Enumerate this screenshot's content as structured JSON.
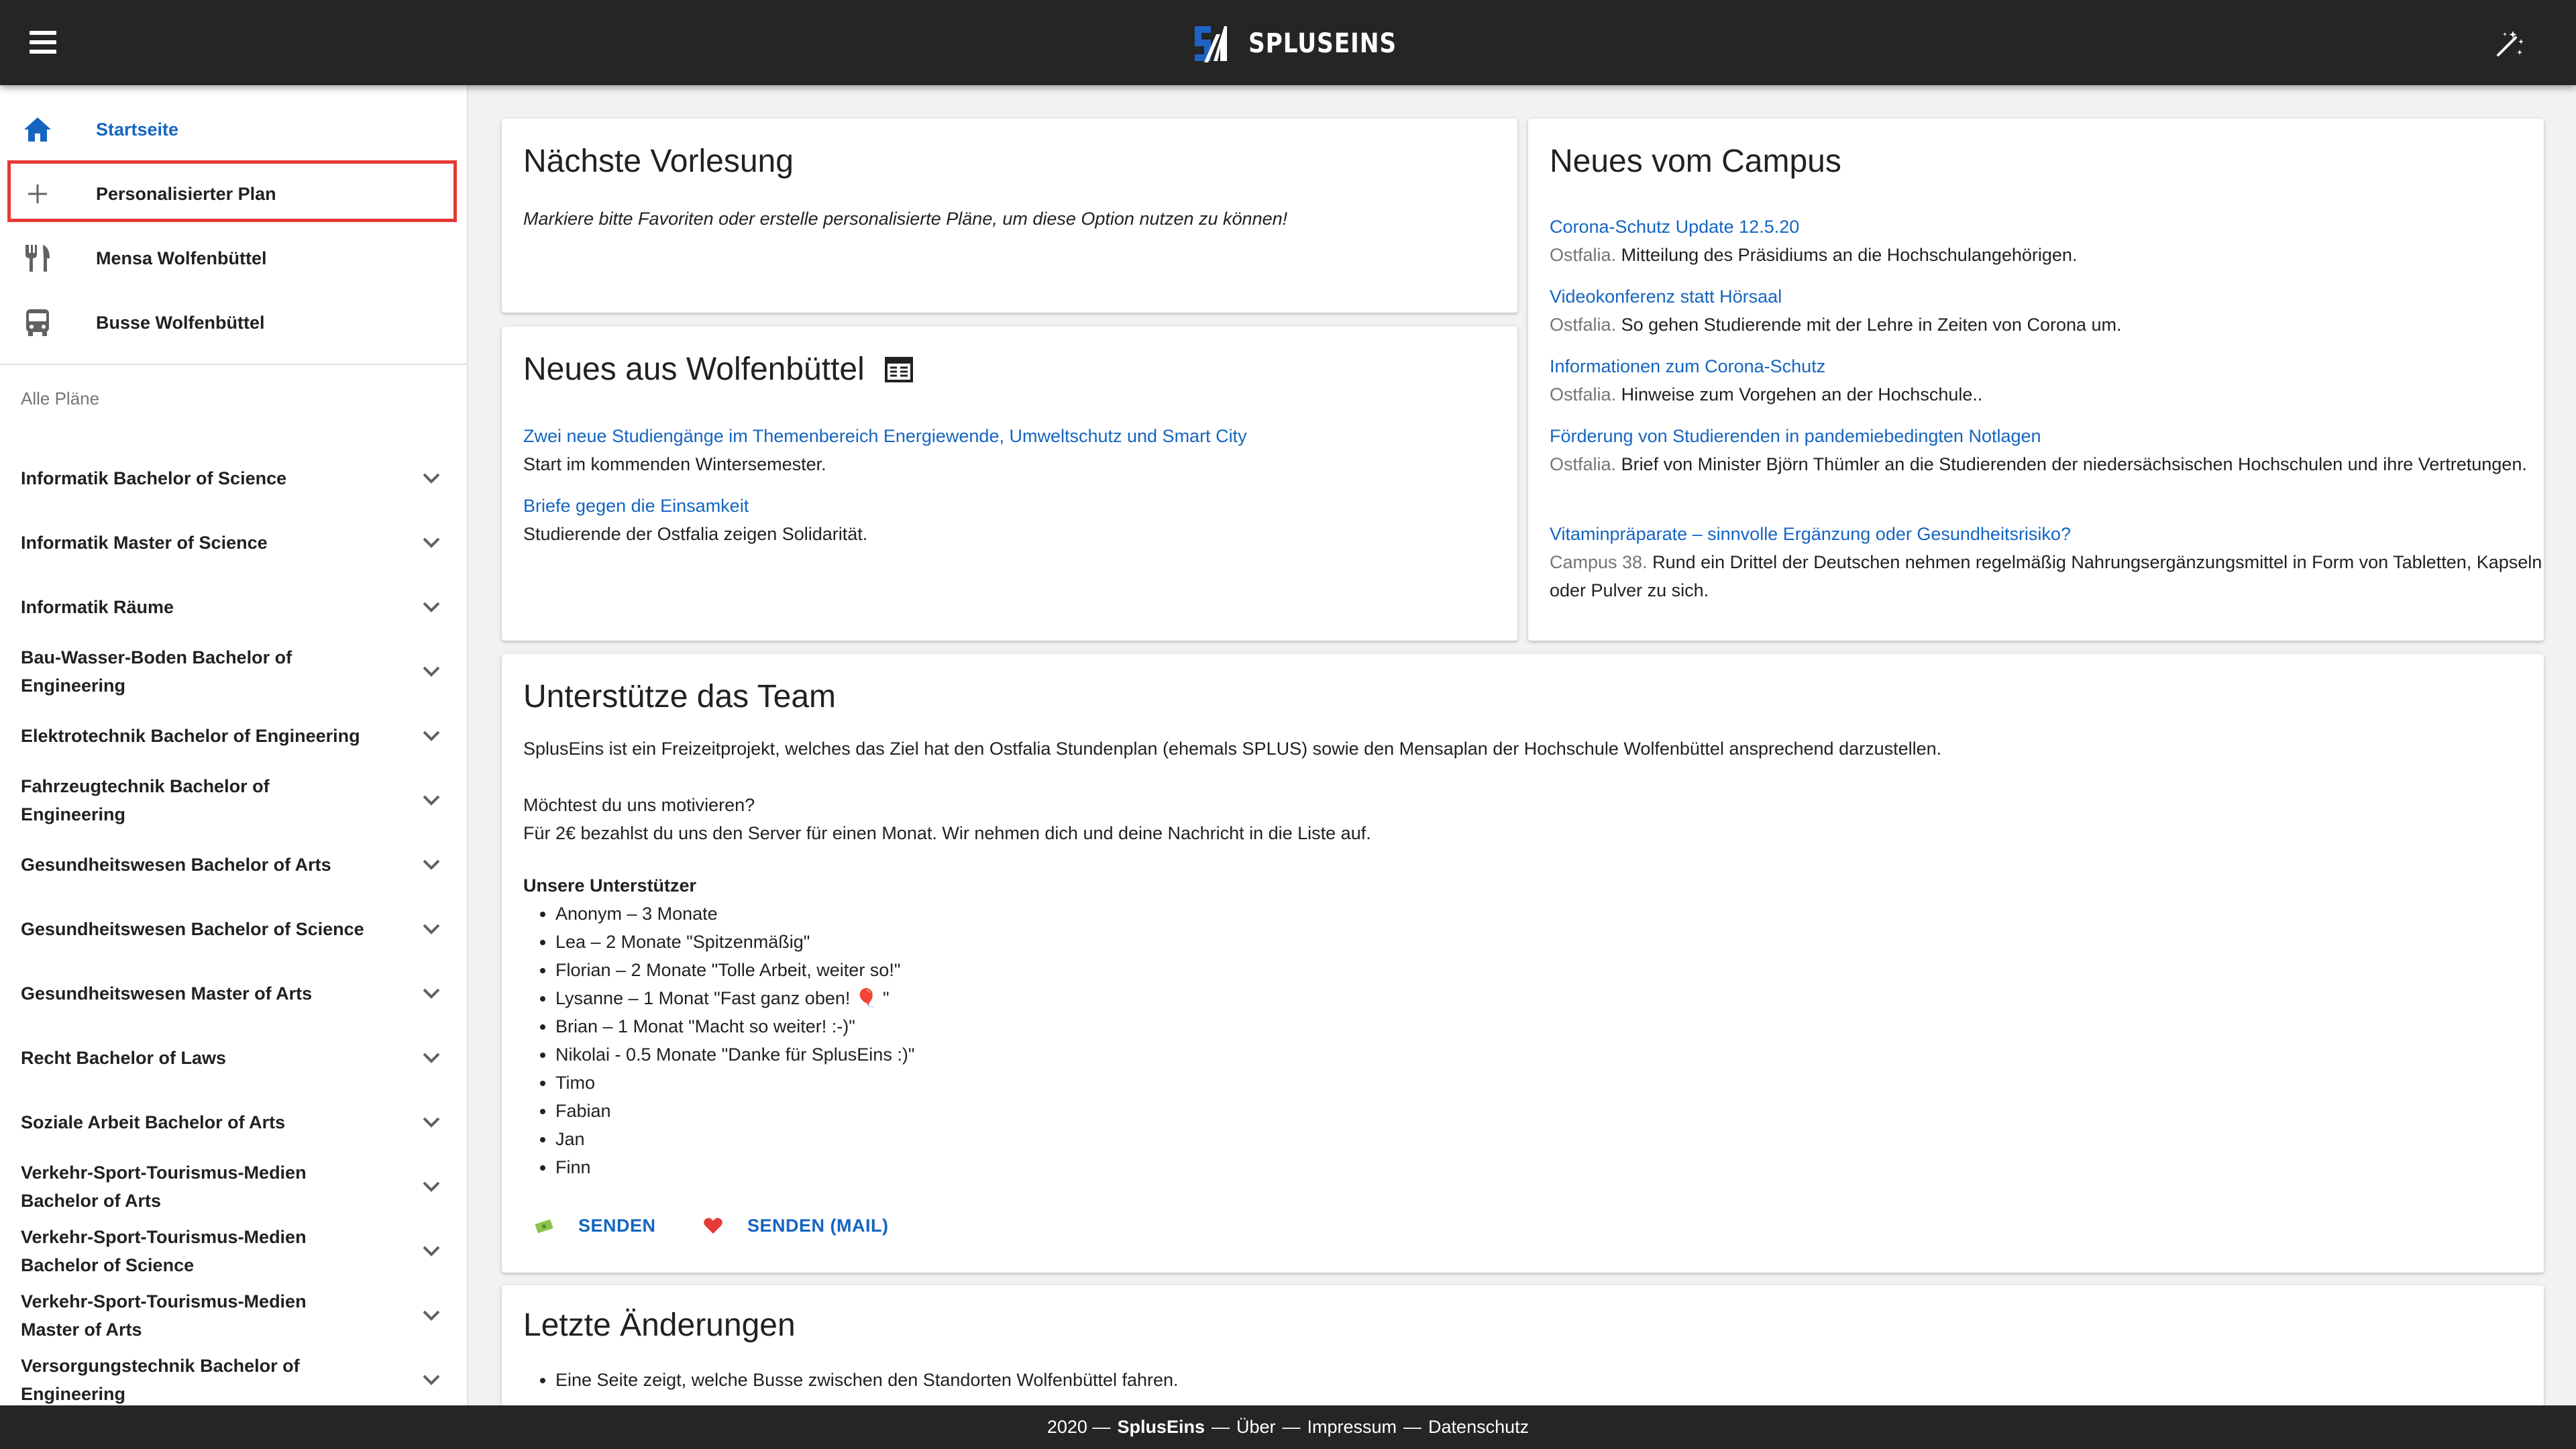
{
  "app": {
    "name": "SPLUSEINS"
  },
  "sidebar": {
    "nav": [
      {
        "label": "Startseite",
        "icon": "home-icon"
      },
      {
        "label": "Personalisierter Plan",
        "icon": "plus-icon"
      },
      {
        "label": "Mensa Wolfenbüttel",
        "icon": "restaurant-icon"
      },
      {
        "label": "Busse Wolfenbüttel",
        "icon": "bus-icon"
      }
    ],
    "subheader": "Alle Pläne",
    "plans": [
      "Informatik Bachelor of Science",
      "Informatik Master of Science",
      "Informatik Räume",
      "Bau-Wasser-Boden Bachelor of Engineering",
      "Elektrotechnik Bachelor of Engineering",
      "Fahrzeugtechnik Bachelor of Engineering",
      "Gesundheitswesen Bachelor of Arts",
      "Gesundheitswesen Bachelor of Science",
      "Gesundheitswesen Master of Arts",
      "Recht Bachelor of Laws",
      "Soziale Arbeit Bachelor of Arts",
      "Verkehr-Sport-Tourismus-Medien Bachelor of Arts",
      "Verkehr-Sport-Tourismus-Medien Bachelor of Science",
      "Verkehr-Sport-Tourismus-Medien Master of Arts",
      "Versorgungstechnik Bachelor of Engineering"
    ]
  },
  "next_lecture": {
    "title": "Nächste Vorlesung",
    "message": "Markiere bitte Favoriten oder erstelle personalisierte Pläne, um diese Option nutzen zu können!"
  },
  "wolfenbuettel_news": {
    "title": "Neues aus Wolfenbüttel",
    "items": [
      {
        "link": "Zwei neue Studiengänge im Themenbereich Energiewende, Umweltschutz und Smart City",
        "text": "Start im kommenden Wintersemester."
      },
      {
        "link": "Briefe gegen die Einsamkeit",
        "text": "Studierende der Ostfalia zeigen Solidarität."
      }
    ]
  },
  "campus_news": {
    "title": "Neues vom Campus",
    "items": [
      {
        "link": "Corona-Schutz Update 12.5.20",
        "source": "Ostfalia.",
        "text": "Mitteilung des Präsidiums an die Hochschulangehörigen."
      },
      {
        "link": "Videokonferenz statt Hörsaal",
        "source": "Ostfalia.",
        "text": "So gehen Studierende mit der Lehre in Zeiten von Corona um."
      },
      {
        "link": "Informationen zum Corona-Schutz",
        "source": "Ostfalia.",
        "text": "Hinweise zum Vorgehen an der Hochschule.."
      },
      {
        "link": "Förderung von Studierenden in pandemiebedingten Notlagen",
        "source": "Ostfalia.",
        "text": "Brief von Minister Björn Thümler an die Studierenden der niedersächsischen Hochschulen und ihre Vertretungen."
      },
      {
        "link": "Vitaminpräparate – sinnvolle Ergänzung oder Gesundheitsrisiko?",
        "source": "Campus 38.",
        "text": "Rund ein Drittel der Deutschen nehmen regelmäßig Nahrungsergänzungsmittel in Form von Tabletten, Kapseln oder Pulver zu sich."
      }
    ]
  },
  "support": {
    "title": "Unterstütze das Team",
    "intro": "SplusEins ist ein Freizeitprojekt, welches das Ziel hat den Ostfalia Stundenplan (ehemals SPLUS) sowie den Mensaplan der Hochschule Wolfenbüttel ansprechend darzustellen.",
    "question": "Möchtest du uns motivieren?",
    "offer": "Für 2€ bezahlst du uns den Server für einen Monat. Wir nehmen dich und deine Nachricht in die Liste auf.",
    "supporters_title": "Unsere Unterstützer",
    "supporters": [
      "Anonym – 3 Monate",
      "Lea – 2 Monate \"Spitzenmäßig\"",
      "Florian – 2 Monate \"Tolle Arbeit, weiter so!\"",
      "Lysanne – 1 Monat \"Fast ganz oben! 🎈 \"",
      "Brian – 1 Monat \"Macht so weiter! :-)\"",
      "Nikolai - 0.5 Monate \"Danke für SplusEins :)\"",
      "Timo",
      "Fabian",
      "Jan",
      "Finn"
    ],
    "button_send": "SENDEN",
    "button_send_mail": "SENDEN (MAIL)"
  },
  "changes": {
    "title": "Letzte Änderungen",
    "items": [
      "Eine Seite zeigt, welche Busse zwischen den Standorten Wolfenbüttel fahren."
    ]
  },
  "footer": {
    "year": "2020 —",
    "brand": "SplusEins",
    "sep1": "—",
    "about": "Über",
    "sep2": "—",
    "imprint": "Impressum",
    "sep3": "—",
    "privacy": "Datenschutz"
  },
  "colors": {
    "appbar": "#252525",
    "link": "#1565c0",
    "highlight": "#e53935"
  }
}
